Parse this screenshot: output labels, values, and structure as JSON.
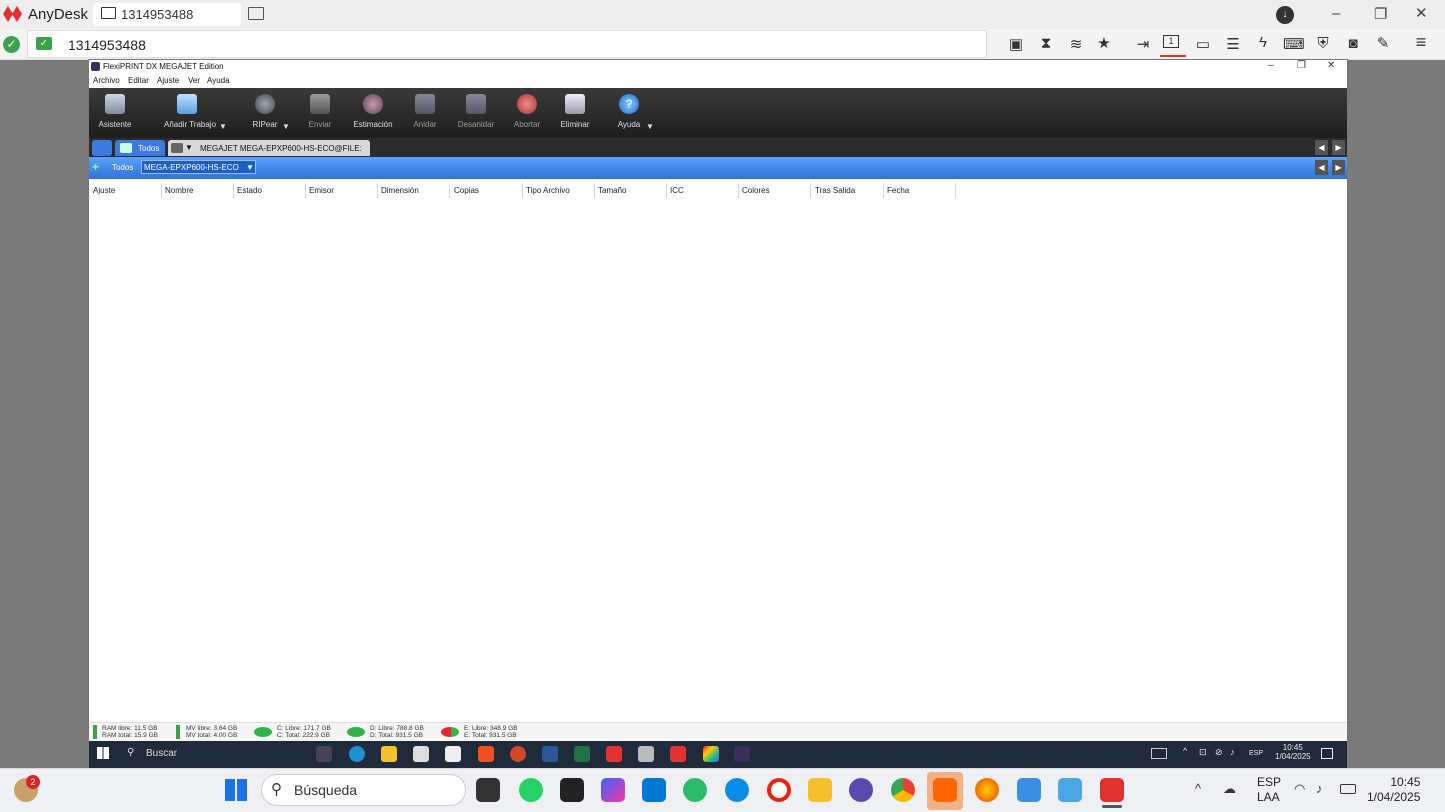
{
  "anydesk": {
    "app_name": "AnyDesk",
    "tab_id": "1314953488",
    "address_value": "1314953488",
    "toolbar_icons": [
      "privacy-icon",
      "hourglass-icon",
      "storage-icon",
      "star-icon",
      "transfer-icon",
      "monitor-1-icon",
      "display-icon",
      "chat-icon",
      "lightning-icon",
      "keyboard-icon",
      "shield-icon",
      "record-icon",
      "pen-icon",
      "menu-icon"
    ],
    "monitor_number": "1"
  },
  "flexi": {
    "title": "FlexiPRINT DX MEGAJET Edition",
    "menu": [
      "Archivo",
      "Editar",
      "Ajuste",
      "Ver",
      "Ayuda"
    ],
    "toolbar": {
      "asistente": "Asistente",
      "anadir": "Añadir Trabajo",
      "ripear": "RIPear",
      "enviar": "Enviar",
      "estimacion": "Estimación",
      "anidar": "Anidar",
      "desanidar": "Desanidar",
      "abortar": "Abortar",
      "eliminar": "Eliminar",
      "ayuda": "Ayuda"
    },
    "tabs": {
      "todos": "Todos",
      "printer": "MEGAJET MEGA-EPXP600-HS-ECO@FILE:"
    },
    "subtabs": {
      "todos": "Todos",
      "printer": "MEGA-EPXP600-HS-ECO"
    },
    "columns": [
      "Ajuste",
      "Nombre",
      "Estado",
      "Emisor",
      "Dimensión",
      "Copias",
      "Tipo Archivo",
      "Tamaño",
      "ICC",
      "Colores",
      "Tras Salida",
      "Fecha"
    ],
    "status": {
      "ram_free": "RAM libre: 11.5 GB",
      "ram_total": "RAM total: 15.9 GB",
      "mv_free": "MV libre: 3.64 GB",
      "mv_total": "MV total: 4.00 GB",
      "c_free": "C: Libre: 171.7 GB",
      "c_total": "C: Total: 222.9 GB",
      "d_free": "D: Libre: 788.8 GB",
      "d_total": "D: Total: 931.5 GB",
      "e_free": "E: Libre: 348.9 GB",
      "e_total": "E: Total: 931.5 GB"
    }
  },
  "remote_taskbar": {
    "search": "Buscar",
    "lang": "ESP",
    "time": "10:45",
    "date": "1/04/2025"
  },
  "local_taskbar": {
    "search": "Búsqueda",
    "lang1": "ESP",
    "lang2": "LAA",
    "time": "10:45",
    "date": "1/04/2025",
    "badge": "2"
  }
}
